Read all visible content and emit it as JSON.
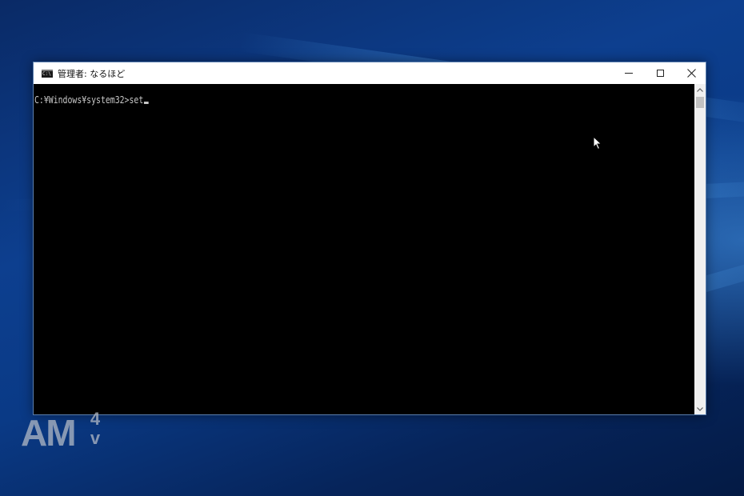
{
  "window": {
    "title": "管理者: なるほど",
    "icon": "cmd-prompt-icon",
    "icon_glyph": "C:\\"
  },
  "console": {
    "prompt": "C:¥Windows¥system32>",
    "command": "set"
  },
  "controls": {
    "minimize": "minimize-icon",
    "maximize": "maximize-icon",
    "close": "close-icon"
  },
  "watermark": {
    "main": "AM",
    "sup": "4",
    "sub": "v"
  },
  "colors": {
    "console_bg": "#000000",
    "console_text": "#c8c8c8",
    "titlebar_bg": "#ffffff",
    "desktop_blue": "#0d3f8f"
  }
}
